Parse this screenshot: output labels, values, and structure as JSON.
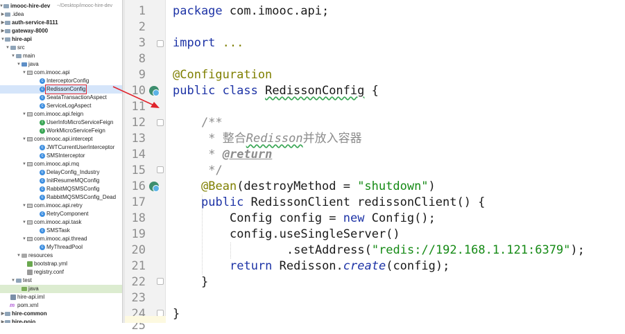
{
  "project_tree": {
    "root_name": "imooc-hire-dev",
    "root_path": "~/Desktop/imooc-hire-dev",
    "items": [
      {
        "label": ".idea"
      },
      {
        "label": "auth-service-8111"
      },
      {
        "label": "gateway-8000"
      },
      {
        "label": "hire-api"
      },
      {
        "label": "src"
      },
      {
        "label": "main"
      },
      {
        "label": "java"
      },
      {
        "label": "com.imooc.api"
      },
      {
        "label": "InterceptorConfig"
      },
      {
        "label": "RedissonConfig"
      },
      {
        "label": "SeataTransactionAspect"
      },
      {
        "label": "ServiceLogAspect"
      },
      {
        "label": "com.imooc.api.feign"
      },
      {
        "label": "UserInfoMicroServiceFeign"
      },
      {
        "label": "WorkMicroServiceFeign"
      },
      {
        "label": "com.imooc.api.intercept"
      },
      {
        "label": "JWTCurrentUserInterceptor"
      },
      {
        "label": "SMSInterceptor"
      },
      {
        "label": "com.imooc.api.mq"
      },
      {
        "label": "DelayConfig_Industry"
      },
      {
        "label": "InitResumeMQConfig"
      },
      {
        "label": "RabbitMQSMSConfig"
      },
      {
        "label": "RabbitMQSMSConfig_Dead"
      },
      {
        "label": "com.imooc.api.retry"
      },
      {
        "label": "RetryComponent"
      },
      {
        "label": "com.imooc.api.task"
      },
      {
        "label": "SMSTask"
      },
      {
        "label": "com.imooc.api.thread"
      },
      {
        "label": "MyThreadPool"
      },
      {
        "label": "resources"
      },
      {
        "label": "bootstrap.yml"
      },
      {
        "label": "registry.conf"
      },
      {
        "label": "test"
      },
      {
        "label": "java"
      },
      {
        "label": "hire-api.iml"
      },
      {
        "label": "pom.xml"
      },
      {
        "label": "hire-common"
      },
      {
        "label": "hire-pojo"
      }
    ]
  },
  "editor": {
    "line_numbers": [
      "1",
      "2",
      "3",
      "8",
      "9",
      "10",
      "11",
      "12",
      "13",
      "14",
      "15",
      "16",
      "17",
      "18",
      "19",
      "20",
      "21",
      "22",
      "23",
      "24",
      "25"
    ],
    "code": {
      "l1_kw": "package",
      "l1_rest": " com.imooc.api;",
      "l3_kw": "import",
      "l3_rest": " ...",
      "l9_ann": "@Configuration",
      "l10_kw": "public class",
      "l10_name": "RedissonConfig",
      "l10_rest": " {",
      "l12": "/**",
      "l13_a": " * 整合",
      "l13_b": "Redisson",
      "l13_c": "并放入容器",
      "l14_a": " * ",
      "l14_tag": "@return",
      "l15": " */",
      "l16_ann": "@Bean",
      "l16_a": "(destroyMethod = ",
      "l16_str": "\"shutdown\"",
      "l16_b": ")",
      "l17_kw": "public",
      "l17_rest": " RedissonClient redissonClient() {",
      "l18_a": "Config config = ",
      "l18_kw": "new",
      "l18_b": " Config();",
      "l19_a": "config.",
      "l19_b": "useSingleServer()",
      "l20_a": ".setAddress(",
      "l20_str": "\"redis://192.168.1.121:6379\"",
      "l20_b": ");",
      "l21_kw": "return",
      "l21_a": " Redisson.",
      "l21_it": "create",
      "l21_b": "(config);",
      "l22": "}",
      "l24": "}"
    }
  },
  "colors": {
    "keyword": "#1d33a6",
    "annotation": "#7f7f00",
    "string": "#158a15",
    "comment": "#8c8c8c",
    "selection": "#d5e5fa",
    "highlight_box": "#e0242c"
  }
}
